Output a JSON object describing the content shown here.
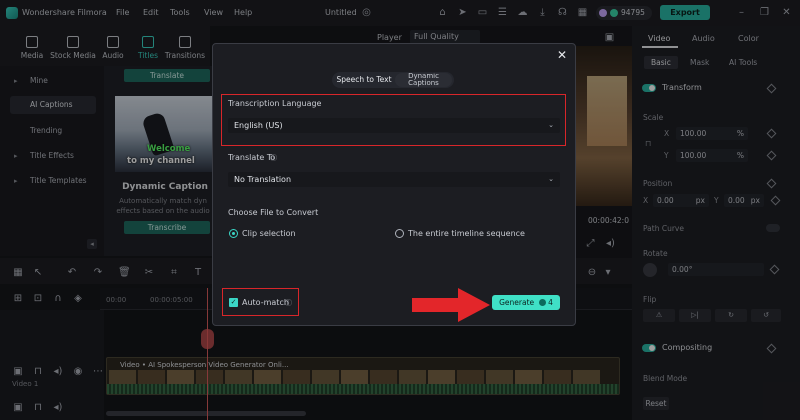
{
  "app": {
    "name": "Wondershare Filmora",
    "menu": [
      "File",
      "Edit",
      "Tools",
      "View",
      "Help"
    ],
    "project_title": "Untitled",
    "credits": "94795",
    "export_label": "Export"
  },
  "media_toolbar": [
    "Media",
    "Stock Media",
    "Audio",
    "Titles",
    "Transitions"
  ],
  "left_sidebar": {
    "items": [
      {
        "label": "Mine",
        "caret": true
      },
      {
        "label": "AI Captions",
        "active": true
      },
      {
        "label": "Trending"
      },
      {
        "label": "Title Effects",
        "caret": true
      },
      {
        "label": "Title Templates",
        "caret": true
      }
    ]
  },
  "caption_panel": {
    "translate_btn": "Translate",
    "thumb_caption_1": "Welcome",
    "thumb_caption_2": "to my channel",
    "title": "Dynamic Caption",
    "desc_1": "Automatically match dyn",
    "desc_2": "effects based on the audio",
    "transcribe_btn": "Transcribe"
  },
  "player": {
    "tab": "Player",
    "quality": "Full Quality",
    "time": "00:00:42:0"
  },
  "right_panel": {
    "tabs": [
      "Video",
      "Audio",
      "Color"
    ],
    "subtabs": [
      "Basic",
      "Mask",
      "AI Tools"
    ],
    "transform": "Transform",
    "scale_label": "Scale",
    "scale_x": "100.00",
    "scale_y": "100.00",
    "percent": "%",
    "position_label": "Position",
    "pos_x": "0.00",
    "pos_y": "0.00",
    "px": "px",
    "axis_x": "X",
    "axis_y": "Y",
    "path_curve": "Path Curve",
    "rotate_label": "Rotate",
    "rotate_value": "0.00°",
    "flip_label": "Flip",
    "compositing": "Compositing",
    "blend_mode": "Blend Mode",
    "reset": "Reset"
  },
  "timeline": {
    "tick_0": "00:00",
    "tick_1": "00:00:05:00",
    "clip_label": "Video • AI Spokesperson Video Generator Onli...",
    "track_label": "Video 1"
  },
  "modal": {
    "tab_speech": "Speech to Text",
    "tab_dynamic": "Dynamic Captions",
    "transcription_label": "Transcription Language",
    "transcription_value": "English (US)",
    "translate_label": "Translate To",
    "translate_value": "No Translation",
    "file_label": "Choose File to Convert",
    "radio_clip": "Clip selection",
    "radio_sequence": "The entire timeline sequence",
    "auto_match": "Auto-match",
    "generate": "Generate",
    "generate_cost": "4",
    "close": "✕"
  },
  "colors": {
    "accent": "#3fe0c6",
    "highlight_box": "#d8262a",
    "arrow": "#e3262a"
  }
}
